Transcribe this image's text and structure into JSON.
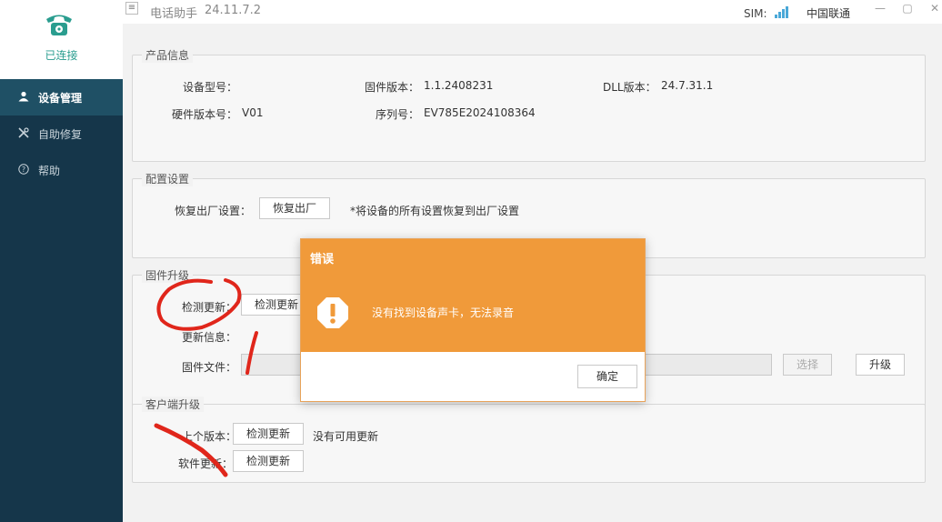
{
  "sidebar": {
    "status": "已连接",
    "items": [
      {
        "label": "设备管理",
        "icon": "user-icon",
        "active": true
      },
      {
        "label": "自助修复",
        "icon": "tools-icon",
        "active": false
      },
      {
        "label": "帮助",
        "icon": "help-icon",
        "active": false
      }
    ]
  },
  "titlebar": {
    "app_name": "电话助手",
    "version": "24.11.7.2",
    "sim_label": "SIM:",
    "carrier": "中国联通"
  },
  "product_info": {
    "title": "产品信息",
    "device_model_label": "设备型号：",
    "device_model_value": "",
    "firmware_version_label": "固件版本：",
    "firmware_version_value": "1.1.2408231",
    "dll_version_label": "DLL版本：",
    "dll_version_value": "24.7.31.1",
    "hardware_version_label": "硬件版本号：",
    "hardware_version_value": "V01",
    "serial_label": "序列号：",
    "serial_value": "EV785E2024108364"
  },
  "config": {
    "title": "配置设置",
    "restore_label": "恢复出厂设置：",
    "restore_button": "恢复出厂",
    "restore_note": "*将设备的所有设置恢复到出厂设置"
  },
  "firmware": {
    "title": "固件升级",
    "check_label": "检测更新：",
    "check_button": "检测更新",
    "update_info_label": "更新信息：",
    "file_label": "固件文件：",
    "select_button": "选择",
    "upgrade_button": "升级"
  },
  "client": {
    "title": "客户端升级",
    "prev_version_label": "上个版本：",
    "prev_check_button": "检测更新",
    "prev_status": "没有可用更新",
    "software_label": "软件更新：",
    "software_check_button": "检测更新"
  },
  "dialog": {
    "title": "错误",
    "message": "没有找到设备声卡，无法录音",
    "ok_button": "确定",
    "icon": "warning-icon"
  },
  "colors": {
    "sidebar_bg": "#15364a",
    "sidebar_active": "#1f5065",
    "dialog_orange": "#f09a3a",
    "status_green": "#2a9d8f",
    "annotation_red": "#e0261b"
  }
}
